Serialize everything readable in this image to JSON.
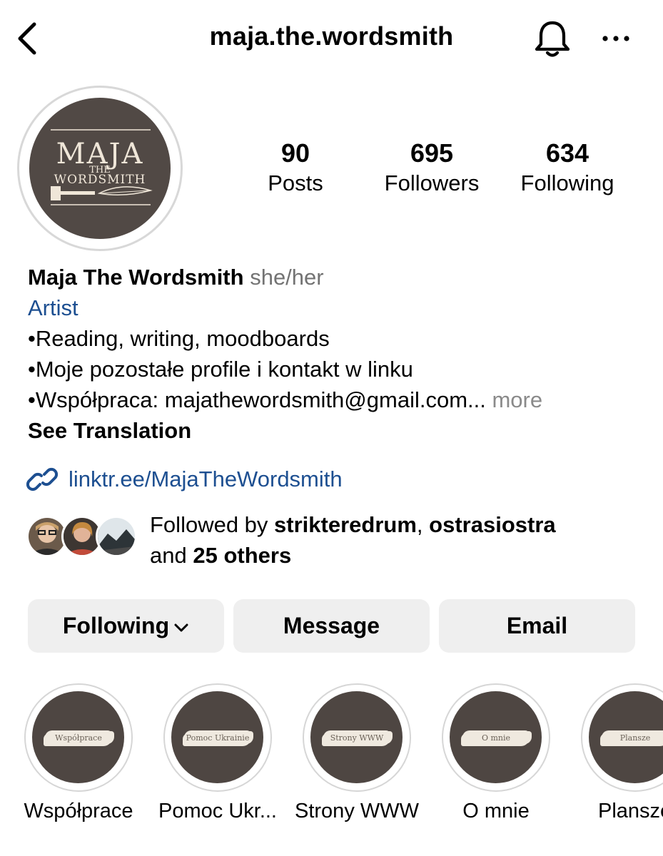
{
  "header": {
    "username": "maja.the.wordsmith",
    "back_icon": "chevron-left-icon",
    "bell_icon": "bell-icon",
    "more_icon": "ellipsis-icon"
  },
  "avatar": {
    "logo_line1": "MAJA",
    "logo_line2": "THE",
    "logo_line3": "WORDSMITH"
  },
  "stats": [
    {
      "value": "90",
      "label": "Posts"
    },
    {
      "value": "695",
      "label": "Followers"
    },
    {
      "value": "634",
      "label": "Following"
    }
  ],
  "bio": {
    "name": "Maja The Wordsmith",
    "pronouns": "she/her",
    "category": "Artist",
    "line1": "•Reading, writing, moodboards",
    "line2": "•Moje pozostałe profile i kontakt w linku",
    "line3": "•Współpraca: majathewordsmith@gmail.com...",
    "more": "more",
    "see_translation": "See Translation",
    "link": "linktr.ee/MajaTheWordsmith"
  },
  "followed_by": {
    "prefix": "Followed by",
    "user1": "strikteredrum",
    "separator": ",",
    "user2": "ostrasiostra",
    "and": "and",
    "others": "25 others"
  },
  "buttons": {
    "following": "Following",
    "message": "Message",
    "email": "Email"
  },
  "highlights": [
    {
      "cover_text": "Współprace",
      "label": "Współprace"
    },
    {
      "cover_text": "Pomoc Ukrainie",
      "label": "Pomoc Ukr..."
    },
    {
      "cover_text": "Strony WWW",
      "label": "Strony WWW"
    },
    {
      "cover_text": "O mnie",
      "label": "O mnie"
    },
    {
      "cover_text": "Plansze",
      "label": "Plansze"
    }
  ],
  "colors": {
    "link_blue": "#1d4f91",
    "button_bg": "#efefef",
    "avatar_bg": "#514945"
  }
}
